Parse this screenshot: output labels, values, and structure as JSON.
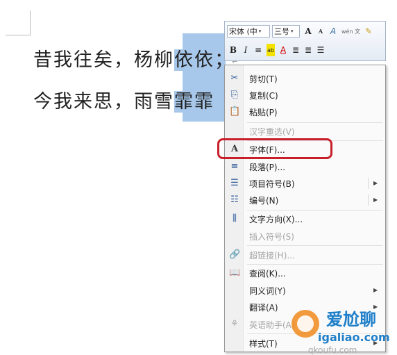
{
  "document": {
    "line1": {
      "plain": "昔我往矣，杨柳",
      "selected": "依依",
      "tail": "；"
    },
    "line2": {
      "plain": "今我来思，雨雪",
      "selected": "霏霏"
    },
    "para_mark": "↵"
  },
  "mini_toolbar": {
    "font_name": "宋体 (中",
    "font_size": "三号",
    "grow_font": "A",
    "shrink_font": "A",
    "styles": "A",
    "phonetic": "wén 文",
    "bold": "B",
    "italic": "I",
    "center": "≡",
    "highlight": "ab",
    "font_color": "A",
    "decrease_indent": "≣",
    "increase_indent": "≣",
    "bullets": "☰",
    "drop": "▾"
  },
  "context_menu": {
    "items": [
      {
        "label": "剪切(T)",
        "icon": "scissors-icon",
        "glyph": "✂",
        "enabled": true
      },
      {
        "label": "复制(C)",
        "icon": "copy-icon",
        "glyph": "⎘",
        "enabled": true
      },
      {
        "label": "粘贴(P)",
        "icon": "paste-icon",
        "glyph": "📋",
        "enabled": true
      },
      {
        "label": "汉字重选(V)",
        "icon": "",
        "glyph": "",
        "enabled": false
      },
      {
        "label": "字体(F)...",
        "icon": "font-icon",
        "glyph": "A",
        "enabled": true
      },
      {
        "label": "段落(P)...",
        "icon": "paragraph-icon",
        "glyph": "≡",
        "enabled": true
      },
      {
        "label": "项目符号(B)",
        "icon": "bullets-icon",
        "glyph": "☰",
        "enabled": true,
        "submenu": true
      },
      {
        "label": "编号(N)",
        "icon": "numbering-icon",
        "glyph": "☷",
        "enabled": true,
        "submenu": true
      },
      {
        "label": "文字方向(X)...",
        "icon": "text-direction-icon",
        "glyph": "⫼",
        "enabled": true
      },
      {
        "label": "插入符号(S)",
        "icon": "",
        "glyph": "",
        "enabled": false
      },
      {
        "label": "超链接(H)...",
        "icon": "hyperlink-icon",
        "glyph": "🔗",
        "enabled": false
      },
      {
        "label": "查阅(K)...",
        "icon": "lookup-icon",
        "glyph": "📖",
        "enabled": true
      },
      {
        "label": "同义词(Y)",
        "icon": "",
        "glyph": "",
        "enabled": true,
        "submenu": true
      },
      {
        "label": "翻译(A)",
        "icon": "",
        "glyph": "",
        "enabled": true,
        "submenu": true
      },
      {
        "label": "英语助手(A)",
        "icon": "english-assistant-icon",
        "glyph": "⚘",
        "enabled": false
      },
      {
        "label": "样式(T)",
        "icon": "",
        "glyph": "",
        "enabled": true,
        "submenu": true
      }
    ],
    "submenu_arrow": "▶"
  },
  "watermark": {
    "brand_text": "爱尬聊",
    "domain": "igaliao.com",
    "faint_text": "qkoufu.com"
  },
  "colors": {
    "selection": "#a7c8ea",
    "highlight_ring": "#c8202a",
    "watermark_blue": "#1f7fc9",
    "watermark_orange": "#f08a1c"
  }
}
